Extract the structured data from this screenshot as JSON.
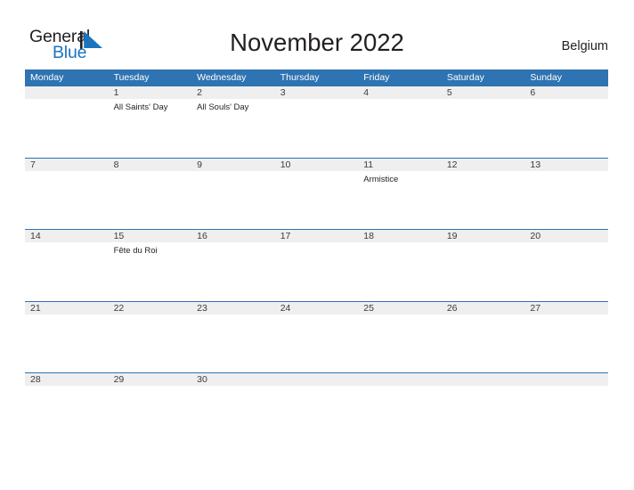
{
  "brand": {
    "name_line1": "General",
    "name_line2": "Blue",
    "flag_icon": "triangle-flag-icon",
    "accent_color": "#1b74c0",
    "text_color": "#231f20"
  },
  "header": {
    "title": "November 2022",
    "country": "Belgium"
  },
  "calendar": {
    "header_color": "#2e73b2",
    "band_color": "#efefef",
    "day_names": [
      "Monday",
      "Tuesday",
      "Wednesday",
      "Thursday",
      "Friday",
      "Saturday",
      "Sunday"
    ],
    "weeks": [
      [
        {
          "day": "",
          "event": ""
        },
        {
          "day": "1",
          "event": "All Saints' Day"
        },
        {
          "day": "2",
          "event": "All Souls' Day"
        },
        {
          "day": "3",
          "event": ""
        },
        {
          "day": "4",
          "event": ""
        },
        {
          "day": "5",
          "event": ""
        },
        {
          "day": "6",
          "event": ""
        }
      ],
      [
        {
          "day": "7",
          "event": ""
        },
        {
          "day": "8",
          "event": ""
        },
        {
          "day": "9",
          "event": ""
        },
        {
          "day": "10",
          "event": ""
        },
        {
          "day": "11",
          "event": "Armistice"
        },
        {
          "day": "12",
          "event": ""
        },
        {
          "day": "13",
          "event": ""
        }
      ],
      [
        {
          "day": "14",
          "event": ""
        },
        {
          "day": "15",
          "event": "Fête du Roi"
        },
        {
          "day": "16",
          "event": ""
        },
        {
          "day": "17",
          "event": ""
        },
        {
          "day": "18",
          "event": ""
        },
        {
          "day": "19",
          "event": ""
        },
        {
          "day": "20",
          "event": ""
        }
      ],
      [
        {
          "day": "21",
          "event": ""
        },
        {
          "day": "22",
          "event": ""
        },
        {
          "day": "23",
          "event": ""
        },
        {
          "day": "24",
          "event": ""
        },
        {
          "day": "25",
          "event": ""
        },
        {
          "day": "26",
          "event": ""
        },
        {
          "day": "27",
          "event": ""
        }
      ],
      [
        {
          "day": "28",
          "event": ""
        },
        {
          "day": "29",
          "event": ""
        },
        {
          "day": "30",
          "event": ""
        },
        {
          "day": "",
          "event": ""
        },
        {
          "day": "",
          "event": ""
        },
        {
          "day": "",
          "event": ""
        },
        {
          "day": "",
          "event": ""
        }
      ]
    ]
  }
}
